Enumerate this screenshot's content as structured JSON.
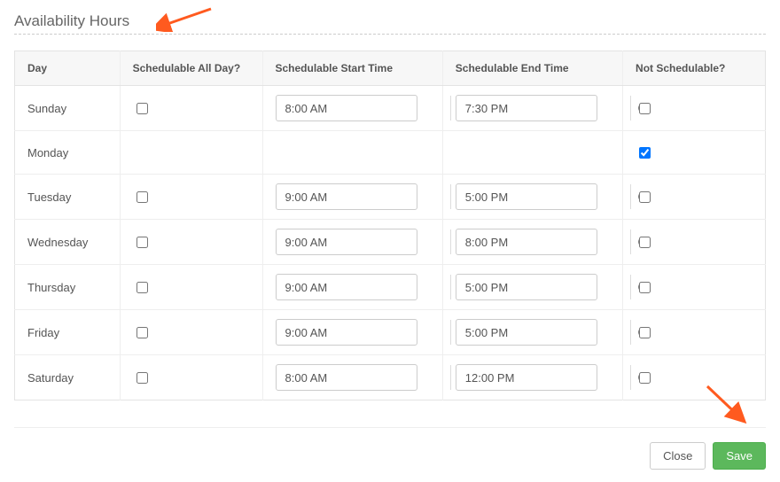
{
  "section_title": "Availability Hours",
  "headers": {
    "day": "Day",
    "allday": "Schedulable All Day?",
    "start": "Schedulable Start Time",
    "end": "Schedulable End Time",
    "not": "Not Schedulable?"
  },
  "rows": [
    {
      "day": "Sunday",
      "allday": false,
      "start": "8:00 AM",
      "end": "7:30 PM",
      "not": false,
      "show_times": true
    },
    {
      "day": "Monday",
      "allday": false,
      "start": "",
      "end": "",
      "not": true,
      "show_times": false
    },
    {
      "day": "Tuesday",
      "allday": false,
      "start": "9:00 AM",
      "end": "5:00 PM",
      "not": false,
      "show_times": true
    },
    {
      "day": "Wednesday",
      "allday": false,
      "start": "9:00 AM",
      "end": "8:00 PM",
      "not": false,
      "show_times": true
    },
    {
      "day": "Thursday",
      "allday": false,
      "start": "9:00 AM",
      "end": "5:00 PM",
      "not": false,
      "show_times": true
    },
    {
      "day": "Friday",
      "allday": false,
      "start": "9:00 AM",
      "end": "5:00 PM",
      "not": false,
      "show_times": true
    },
    {
      "day": "Saturday",
      "allday": false,
      "start": "8:00 AM",
      "end": "12:00 PM",
      "not": false,
      "show_times": true
    }
  ],
  "buttons": {
    "close": "Close",
    "save": "Save"
  }
}
